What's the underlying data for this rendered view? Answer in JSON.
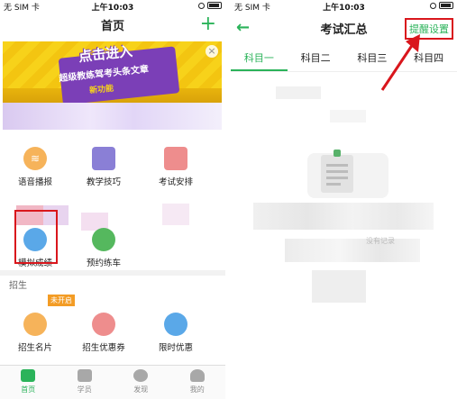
{
  "left": {
    "status": {
      "carrier": "无 SIM 卡",
      "time": "上午10:03"
    },
    "nav": {
      "title": "首页",
      "plus": "+"
    },
    "banner": {
      "line1": "点击进入",
      "line2": "超级教练驾考头条文章",
      "line3": "新功能",
      "close": "×"
    },
    "grid": [
      {
        "label": "语音播报",
        "icon": "sound-wave-icon",
        "color": "#f6b35a"
      },
      {
        "label": "教学技巧",
        "icon": "book-icon",
        "color": "#8a7fd6"
      },
      {
        "label": "考试安排",
        "icon": "calendar-icon",
        "color": "#ee8d8d"
      },
      {
        "label": "模拟成绩",
        "icon": "score-icon",
        "color": "#5aa8e8"
      },
      {
        "label": "预约练车",
        "icon": "car-icon",
        "color": "#55b85e"
      }
    ],
    "recruit": {
      "title": "招生",
      "tag": "未开启",
      "items": [
        {
          "label": "招生名片",
          "icon": "card-icon",
          "color": "#f6b35a"
        },
        {
          "label": "招生优惠券",
          "icon": "coupon-icon",
          "color": "#ee8d8d"
        },
        {
          "label": "限时优惠",
          "icon": "clock-icon",
          "color": "#5aa8e8"
        }
      ]
    },
    "tabs": [
      {
        "label": "首页",
        "icon": "home-icon"
      },
      {
        "label": "学员",
        "icon": "students-icon"
      },
      {
        "label": "发现",
        "icon": "compass-icon"
      },
      {
        "label": "我的",
        "icon": "person-icon"
      }
    ]
  },
  "right": {
    "status": {
      "carrier": "无 SIM 卡",
      "time": "上午10:03"
    },
    "nav": {
      "back": "←",
      "title": "考试汇总",
      "action": "提醒设置"
    },
    "subjects": [
      "科目一",
      "科目二",
      "科目三",
      "科目四"
    ],
    "empty_fragment": "没有记录"
  }
}
